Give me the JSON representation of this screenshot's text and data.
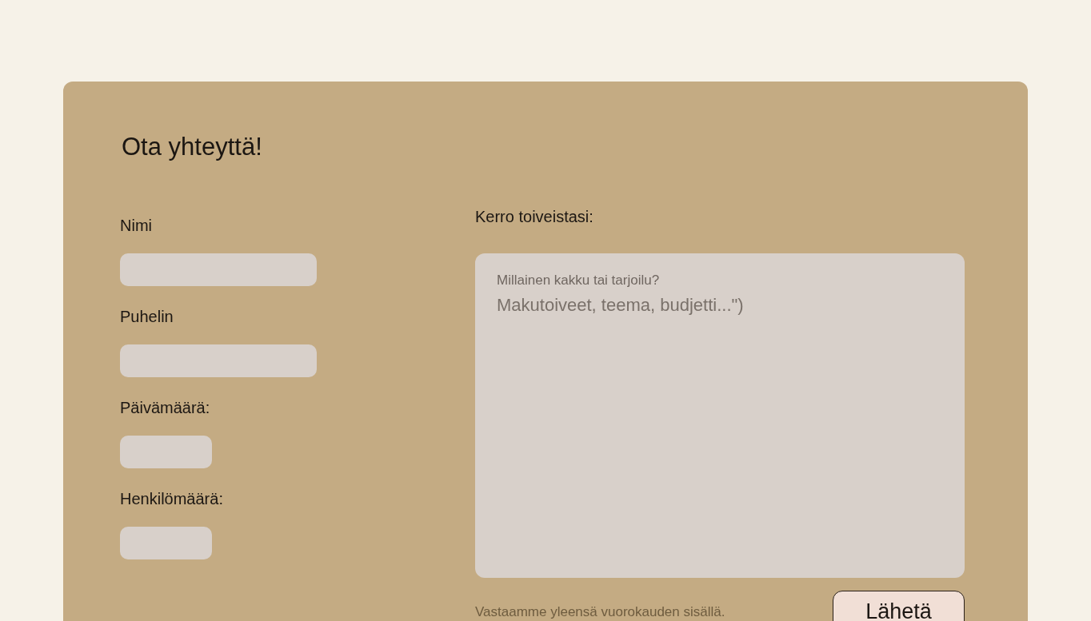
{
  "form": {
    "title": "Ota yhteyttä!",
    "fields": [
      {
        "label": "Nimi",
        "kind": "text"
      },
      {
        "label": "Puhelin",
        "kind": "tel"
      },
      {
        "label": "Päivämäärä:",
        "kind": "date"
      },
      {
        "label": "Henkilömäärä:",
        "kind": "number"
      }
    ],
    "message": {
      "label": "Kerro toiveistasi:",
      "hint": "Millainen kakku tai tarjoilu?",
      "placeholder": "Makutoiveet, teema, budjetti...\")"
    },
    "note": "Vastaamme yleensä vuorokauden sisällä.",
    "submit": "Lähetä"
  }
}
